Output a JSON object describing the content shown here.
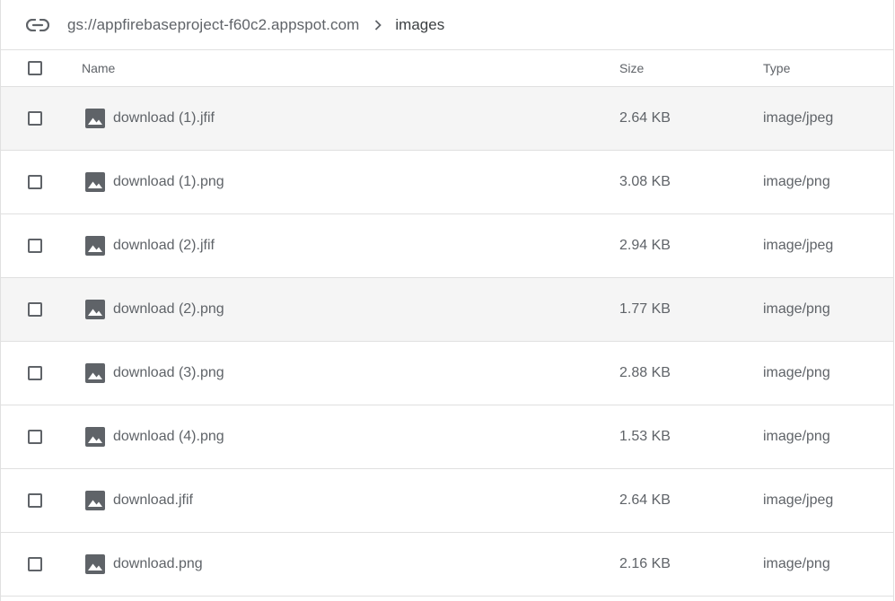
{
  "breadcrumb": {
    "bucket": "gs://appfirebaseproject-f60c2.appspot.com",
    "folder": "images"
  },
  "table": {
    "columns": {
      "name": "Name",
      "size": "Size",
      "type": "Type"
    },
    "rows": [
      {
        "name": "download (1).jfif",
        "size": "2.64 KB",
        "type": "image/jpeg",
        "highlighted": true
      },
      {
        "name": "download (1).png",
        "size": "3.08 KB",
        "type": "image/png",
        "highlighted": false
      },
      {
        "name": "download (2).jfif",
        "size": "2.94 KB",
        "type": "image/jpeg",
        "highlighted": false
      },
      {
        "name": "download (2).png",
        "size": "1.77 KB",
        "type": "image/png",
        "highlighted": true
      },
      {
        "name": "download (3).png",
        "size": "2.88 KB",
        "type": "image/png",
        "highlighted": false
      },
      {
        "name": "download (4).png",
        "size": "1.53 KB",
        "type": "image/png",
        "highlighted": false
      },
      {
        "name": "download.jfif",
        "size": "2.64 KB",
        "type": "image/jpeg",
        "highlighted": false
      },
      {
        "name": "download.png",
        "size": "2.16 KB",
        "type": "image/png",
        "highlighted": false
      }
    ]
  },
  "icons": {
    "path": "link-icon",
    "separator": "chevron-right-icon",
    "file": "image-file-icon"
  },
  "colors": {
    "text": "#5f6368",
    "text_dark": "#3c4043",
    "divider": "#e0e0e0",
    "row_highlight": "#f5f5f5"
  }
}
